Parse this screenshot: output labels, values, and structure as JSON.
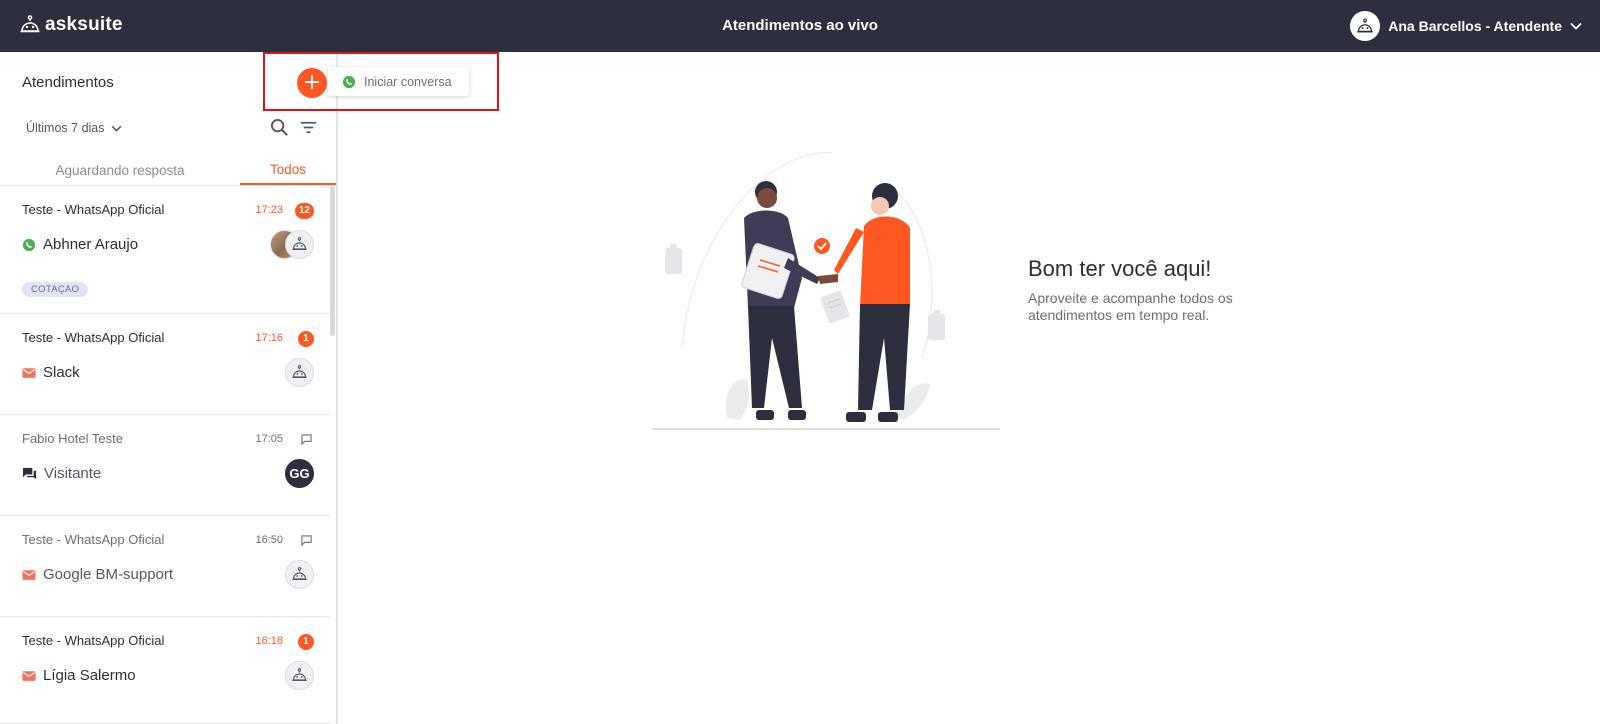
{
  "app": {
    "brand": "asksuite",
    "title": "Atendimentos ao vivo",
    "user_name": "Ana Barcellos - Atendente"
  },
  "sidebar": {
    "title": "Atendimentos",
    "period": "Últimos 7 dias",
    "tabs": [
      {
        "label": "Aguardando resposta",
        "active": false
      },
      {
        "label": "Todos",
        "active": true
      }
    ],
    "conversations": [
      {
        "channel": "Teste - WhatsApp Oficial",
        "time": "17:23",
        "badge": "12",
        "name": "Abhner Araujo",
        "channel_icon": "whatsapp-icon",
        "tag": "COTAÇAO"
      },
      {
        "channel": "Teste - WhatsApp Oficial",
        "time": "17:16",
        "badge": "1",
        "name": "Slack",
        "channel_icon": "email-icon"
      },
      {
        "channel": "Fabio Hotel Teste",
        "time": "17:05",
        "name": "Visitante",
        "channel_icon": "chat-icon",
        "avatar_initials": "GG"
      },
      {
        "channel": "Teste - WhatsApp Oficial",
        "time": "16:50",
        "name": "Google BM-support",
        "channel_icon": "email-icon"
      },
      {
        "channel": "Teste - WhatsApp Oficial",
        "time": "16:18",
        "badge": "1",
        "name": "Lígia Salermo",
        "channel_icon": "email-icon"
      }
    ]
  },
  "popover": {
    "label": "Iniciar conversa",
    "icon": "whatsapp-icon"
  },
  "main": {
    "welcome_title": "Bom ter você aqui!",
    "welcome_subtitle": "Aproveite e acompanhe todos os atendimentos em tempo real."
  },
  "colors": {
    "topbar": "#2d2f3f",
    "accent": "#ff5722",
    "whatsapp": "#4caf50",
    "highlight": "#e0141b"
  }
}
